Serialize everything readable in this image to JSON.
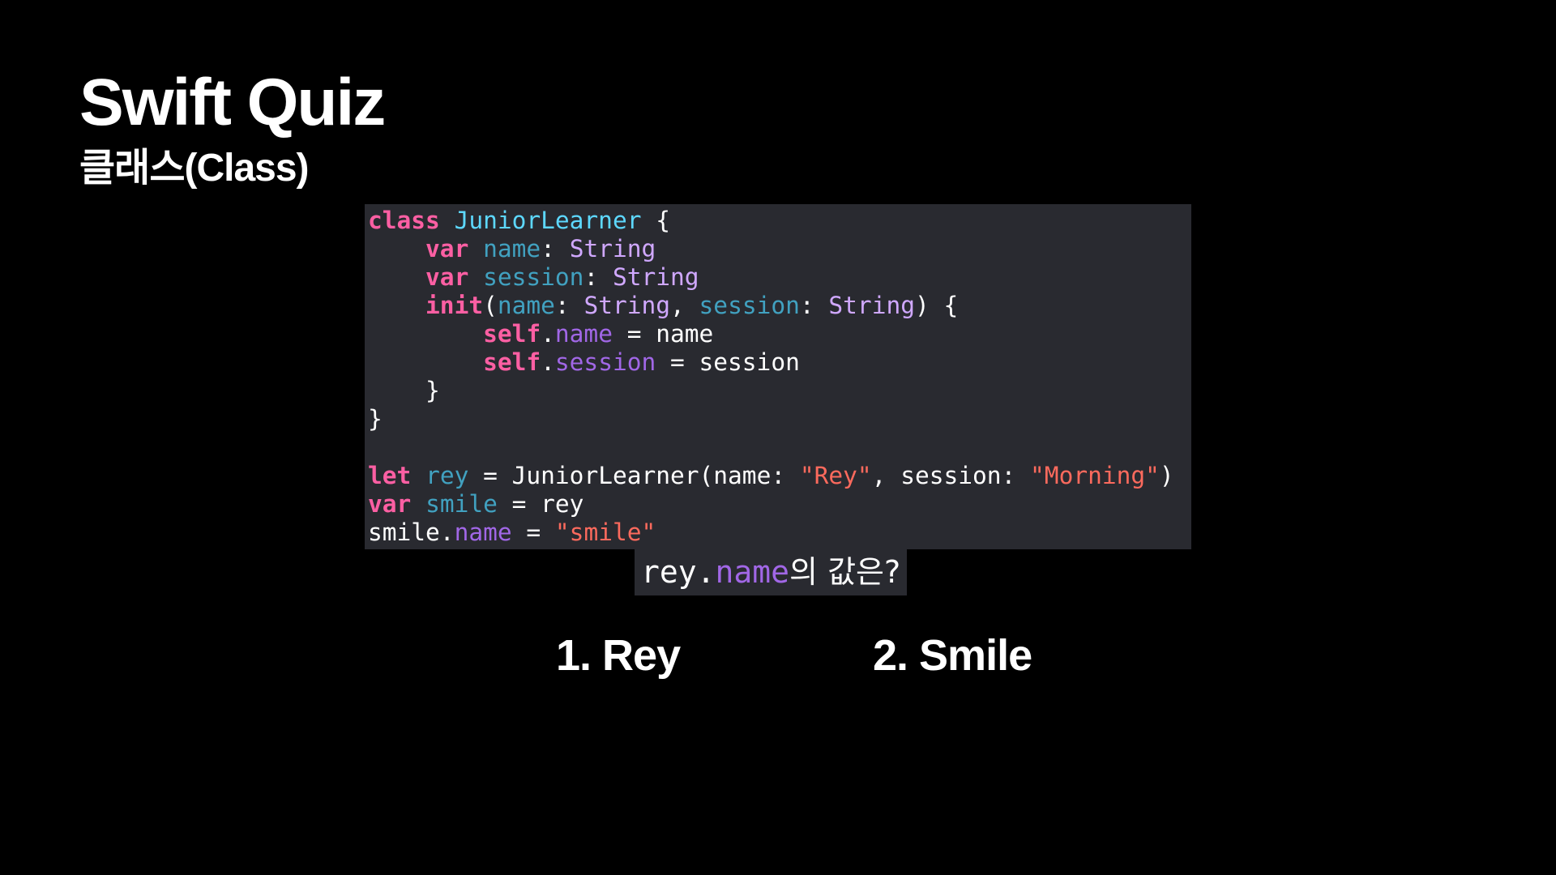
{
  "slide": {
    "title": "Swift Quiz",
    "subtitle": "클래스(Class)"
  },
  "code": {
    "lines": [
      [
        {
          "t": "class",
          "c": "kw"
        },
        {
          "t": " ",
          "c": "plain"
        },
        {
          "t": "JuniorLearner",
          "c": "type-decl"
        },
        {
          "t": " {",
          "c": "plain"
        }
      ],
      [
        {
          "t": "    ",
          "c": "plain"
        },
        {
          "t": "var",
          "c": "kw"
        },
        {
          "t": " ",
          "c": "plain"
        },
        {
          "t": "name",
          "c": "prop-decl"
        },
        {
          "t": ": ",
          "c": "plain"
        },
        {
          "t": "String",
          "c": "type"
        }
      ],
      [
        {
          "t": "    ",
          "c": "plain"
        },
        {
          "t": "var",
          "c": "kw"
        },
        {
          "t": " ",
          "c": "plain"
        },
        {
          "t": "session",
          "c": "prop-decl"
        },
        {
          "t": ": ",
          "c": "plain"
        },
        {
          "t": "String",
          "c": "type"
        }
      ],
      [
        {
          "t": "    ",
          "c": "plain"
        },
        {
          "t": "init",
          "c": "kw"
        },
        {
          "t": "(",
          "c": "plain"
        },
        {
          "t": "name",
          "c": "prop-decl"
        },
        {
          "t": ": ",
          "c": "plain"
        },
        {
          "t": "String",
          "c": "type"
        },
        {
          "t": ", ",
          "c": "plain"
        },
        {
          "t": "session",
          "c": "prop-decl"
        },
        {
          "t": ": ",
          "c": "plain"
        },
        {
          "t": "String",
          "c": "type"
        },
        {
          "t": ") {",
          "c": "plain"
        }
      ],
      [
        {
          "t": "        ",
          "c": "plain"
        },
        {
          "t": "self",
          "c": "kw"
        },
        {
          "t": ".",
          "c": "plain"
        },
        {
          "t": "name",
          "c": "member"
        },
        {
          "t": " = name",
          "c": "plain"
        }
      ],
      [
        {
          "t": "        ",
          "c": "plain"
        },
        {
          "t": "self",
          "c": "kw"
        },
        {
          "t": ".",
          "c": "plain"
        },
        {
          "t": "session",
          "c": "member"
        },
        {
          "t": " = session",
          "c": "plain"
        }
      ],
      [
        {
          "t": "    }",
          "c": "plain"
        }
      ],
      [
        {
          "t": "}",
          "c": "plain"
        }
      ],
      [
        {
          "t": "",
          "c": "plain"
        }
      ],
      [
        {
          "t": "let",
          "c": "kw"
        },
        {
          "t": " ",
          "c": "plain"
        },
        {
          "t": "rey",
          "c": "prop-decl"
        },
        {
          "t": " = JuniorLearner(name: ",
          "c": "plain"
        },
        {
          "t": "\"Rey\"",
          "c": "str"
        },
        {
          "t": ", session: ",
          "c": "plain"
        },
        {
          "t": "\"Morning\"",
          "c": "str"
        },
        {
          "t": ")",
          "c": "plain"
        }
      ],
      [
        {
          "t": "var",
          "c": "kw"
        },
        {
          "t": " ",
          "c": "plain"
        },
        {
          "t": "smile",
          "c": "prop-decl"
        },
        {
          "t": " = rey",
          "c": "plain"
        }
      ],
      [
        {
          "t": "smile.",
          "c": "plain"
        },
        {
          "t": "name",
          "c": "member"
        },
        {
          "t": " = ",
          "c": "plain"
        },
        {
          "t": "\"smile\"",
          "c": "str"
        }
      ]
    ]
  },
  "question": {
    "object": "rey.",
    "property": "name",
    "suffix": "의 값은?"
  },
  "answers": {
    "option1": "1. Rey",
    "option2": "2. Smile"
  },
  "colors": {
    "background": "#000000",
    "code_background": "#292a30",
    "keyword": "#fc5fa3",
    "type_declaration": "#5dd8ff",
    "property_declaration": "#41a1c0",
    "type": "#d0a8ff",
    "member": "#a167e6",
    "string": "#fc6a5d",
    "plain": "#ffffff"
  }
}
